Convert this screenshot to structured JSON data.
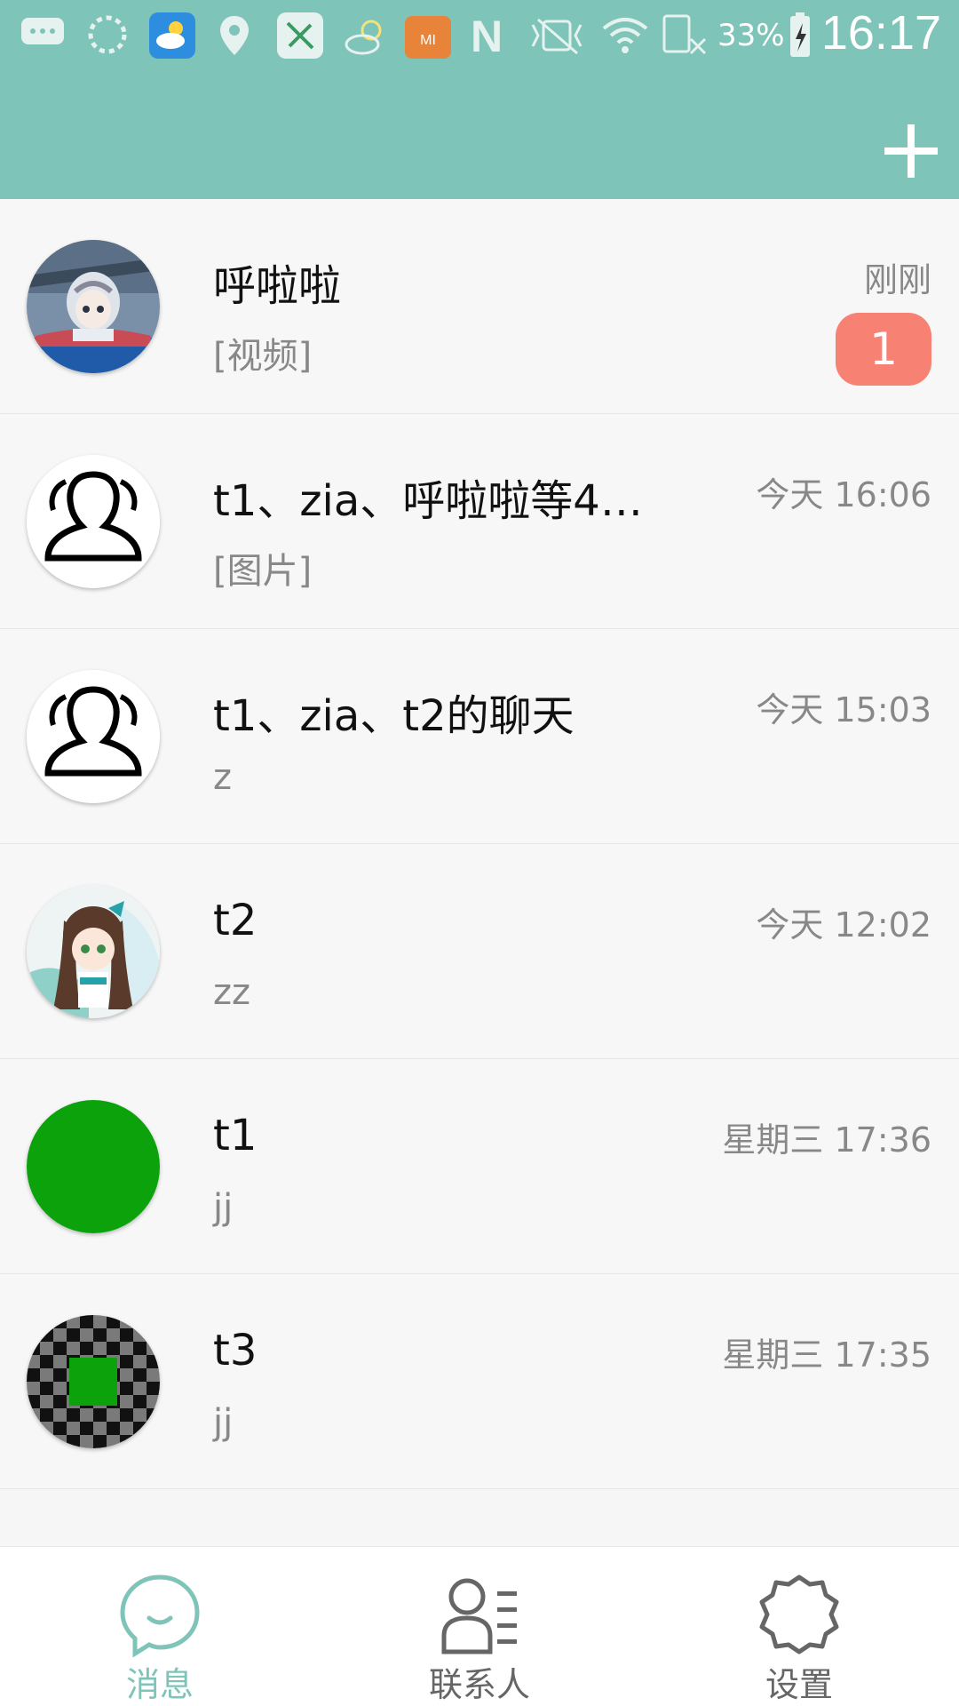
{
  "status_bar": {
    "battery": "33%",
    "time": "16:17"
  },
  "header": {
    "add_icon": "plus-icon"
  },
  "conversations": [
    {
      "name": "呼啦啦",
      "preview": "[视频]",
      "time": "刚刚",
      "badge": "1",
      "avatar": "anime-girl-helmet"
    },
    {
      "name": "t1、zia、呼啦啦等4…",
      "preview": "[图片]",
      "time": "今天 16:06",
      "avatar": "group-icon"
    },
    {
      "name": "t1、zia、t2的聊天",
      "preview": "z",
      "time": "今天 15:03",
      "avatar": "group-icon"
    },
    {
      "name": "t2",
      "preview": "zz",
      "time": "今天 12:02",
      "avatar": "anime-girl-bow"
    },
    {
      "name": "t1",
      "preview": "jj",
      "time": "星期三 17:36",
      "avatar": "green-circle"
    },
    {
      "name": "t3",
      "preview": "jj",
      "time": "星期三 17:35",
      "avatar": "checkerboard"
    }
  ],
  "bottom_nav": {
    "items": [
      {
        "label": "消息",
        "icon": "chat-bubble-icon",
        "active": true
      },
      {
        "label": "联系人",
        "icon": "contacts-icon",
        "active": false
      },
      {
        "label": "设置",
        "icon": "gear-icon",
        "active": false
      }
    ]
  },
  "colors": {
    "header": "#7fc4b8",
    "accent": "#7fc4b8",
    "badge": "#f78172",
    "inactive": "#666666"
  }
}
